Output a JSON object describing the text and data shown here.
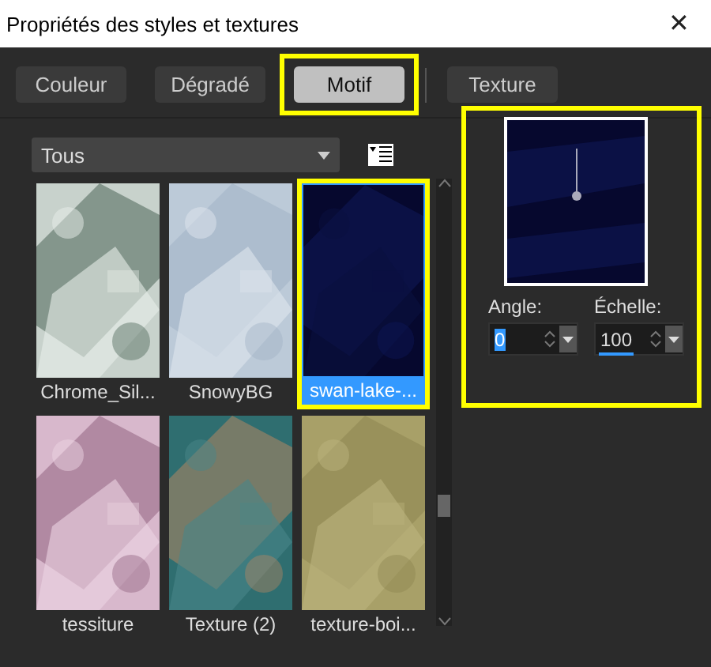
{
  "window": {
    "title": "Propriétés des styles et textures",
    "close": "✕"
  },
  "tabs": [
    {
      "label": "Couleur",
      "selected": false,
      "highlighted": false
    },
    {
      "label": "Dégradé",
      "selected": false,
      "highlighted": false
    },
    {
      "label": "Motif",
      "selected": true,
      "highlighted": true
    },
    {
      "label": "Texture",
      "selected": false,
      "highlighted": false
    }
  ],
  "category": {
    "value": "Tous"
  },
  "patterns": [
    {
      "name": "Chrome_Sil...",
      "selected": false,
      "highlighted": false
    },
    {
      "name": "SnowyBG",
      "selected": false,
      "highlighted": false
    },
    {
      "name": "swan-lake-...",
      "selected": true,
      "highlighted": true
    },
    {
      "name": "tessiture",
      "selected": false,
      "highlighted": false
    },
    {
      "name": "Texture (2)",
      "selected": false,
      "highlighted": false
    },
    {
      "name": "texture-boi...",
      "selected": false,
      "highlighted": false
    }
  ],
  "preview": {
    "highlighted": true
  },
  "angle": {
    "label": "Angle:",
    "value": "0"
  },
  "scale": {
    "label": "Échelle:",
    "value": "100"
  }
}
